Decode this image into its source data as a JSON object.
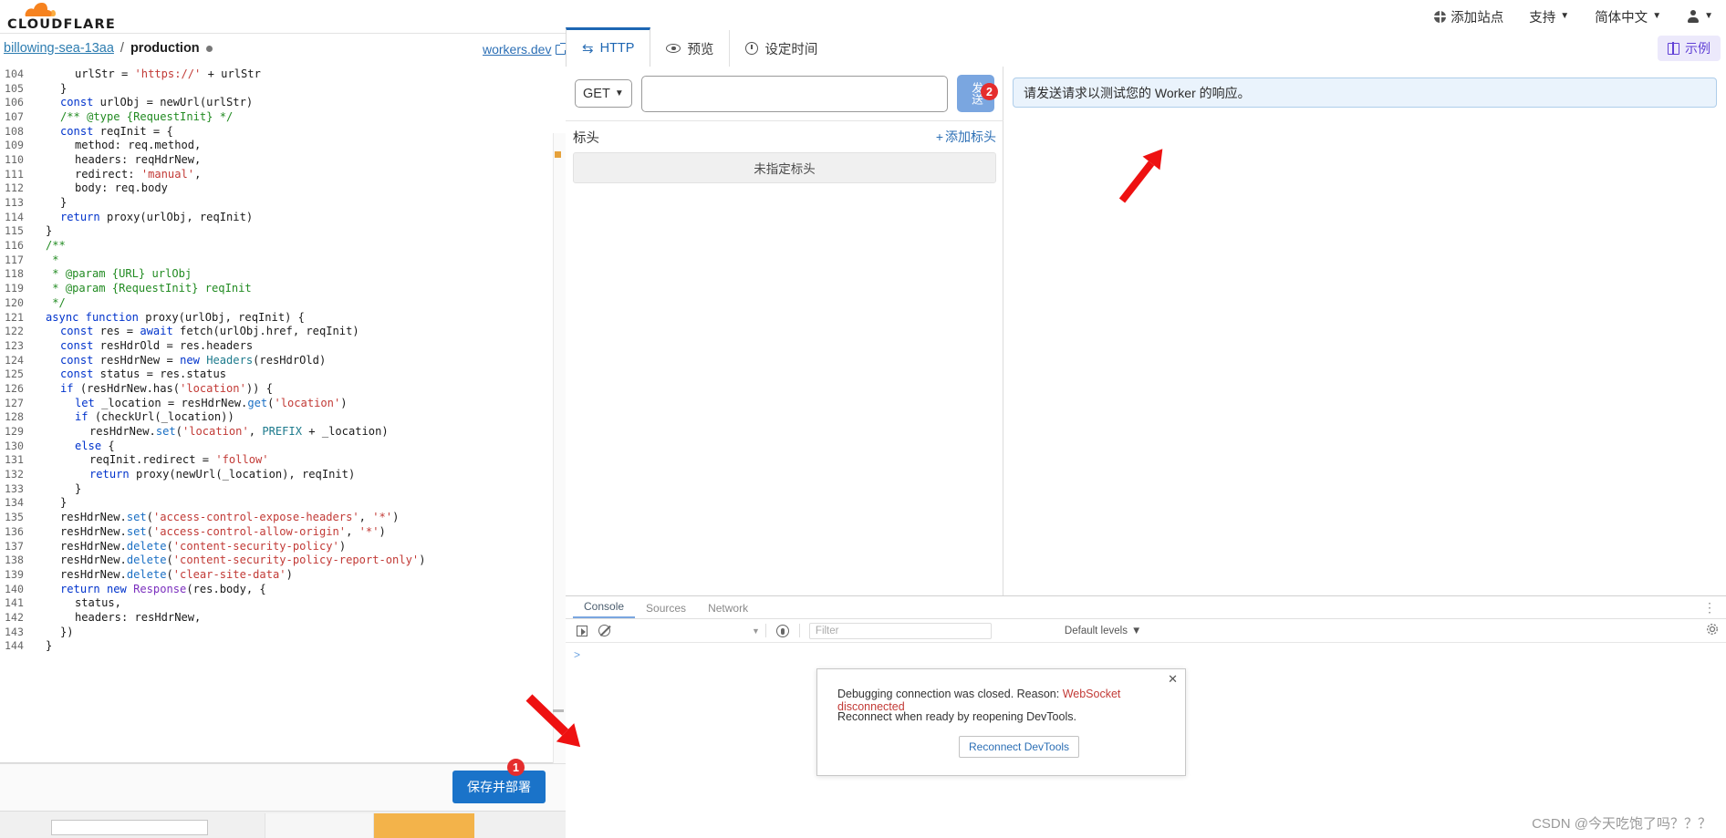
{
  "brand": {
    "name": "CLOUDFLARE",
    "color": "#f6821f"
  },
  "topnav": {
    "add_site": "添加站点",
    "support": "支持",
    "language": "简体中文",
    "caret": "▼"
  },
  "breadcrumb": {
    "worker_name": "billowing-sea-13aa",
    "separator": "/",
    "environment": "production",
    "workers_dev_link": "workers.dev"
  },
  "tabs": [
    {
      "label": "HTTP",
      "icon": "http-swap-icon",
      "active": true
    },
    {
      "label": "预览",
      "icon": "eye-icon",
      "active": false
    },
    {
      "label": "设定时间",
      "icon": "clock-icon",
      "active": false
    }
  ],
  "sample_button": {
    "label": "示例",
    "icon": "book-icon",
    "color": "#6141d6"
  },
  "request": {
    "method": "GET",
    "method_caret": "▼",
    "url_value": "",
    "url_placeholder": "",
    "send_label": "发送",
    "send_badge": "2",
    "headers_label": "标头",
    "add_header_label": "添加标头",
    "add_header_plus": "+",
    "no_headers_text": "未指定标头"
  },
  "response": {
    "message": "请发送请求以测试您的 Worker 的响应。"
  },
  "deploy": {
    "button_label": "保存并部署",
    "badge": "1"
  },
  "devtools": {
    "tabs": [
      "Console",
      "Sources",
      "Network"
    ],
    "active_tab": "Console",
    "kebab": "⋮",
    "toolbar": {
      "execution_context_caret": "▼",
      "filter_placeholder": "Filter",
      "levels_label": "Default levels",
      "levels_caret": "▼"
    },
    "prompt": ">",
    "popup": {
      "close": "✕",
      "line1_prefix": "Debugging connection was closed. Reason: ",
      "line1_error": "WebSocket disconnected",
      "line2": "Reconnect when ready by reopening DevTools.",
      "button_label": "Reconnect DevTools"
    }
  },
  "watermark": "CSDN @今天吃饱了吗？？？",
  "editor": {
    "first_line_number": 104,
    "lines": [
      {
        "n": 104,
        "indent": 3,
        "tokens": [
          {
            "t": "urlStr = ",
            "c": "codetext"
          },
          {
            "t": "'https://'",
            "c": "str"
          },
          {
            "t": " + urlStr",
            "c": "codetext"
          }
        ]
      },
      {
        "n": 105,
        "indent": 2,
        "tokens": [
          {
            "t": "}",
            "c": "codetext"
          }
        ]
      },
      {
        "n": 106,
        "indent": 2,
        "tokens": [
          {
            "t": "const",
            "c": "kw"
          },
          {
            "t": " urlObj = newUrl(urlStr)",
            "c": "codetext"
          }
        ]
      },
      {
        "n": 107,
        "indent": 2,
        "tokens": [
          {
            "t": "/** @type {RequestInit} */",
            "c": "cmt"
          }
        ]
      },
      {
        "n": 108,
        "indent": 2,
        "tokens": [
          {
            "t": "const",
            "c": "kw"
          },
          {
            "t": " reqInit = {",
            "c": "codetext"
          }
        ]
      },
      {
        "n": 109,
        "indent": 3,
        "tokens": [
          {
            "t": "method: req.method,",
            "c": "codetext"
          }
        ]
      },
      {
        "n": 110,
        "indent": 3,
        "tokens": [
          {
            "t": "headers: reqHdrNew,",
            "c": "codetext"
          }
        ]
      },
      {
        "n": 111,
        "indent": 3,
        "tokens": [
          {
            "t": "redirect: ",
            "c": "codetext"
          },
          {
            "t": "'manual'",
            "c": "str"
          },
          {
            "t": ",",
            "c": "codetext"
          }
        ]
      },
      {
        "n": 112,
        "indent": 3,
        "tokens": [
          {
            "t": "body: req.body",
            "c": "codetext"
          }
        ]
      },
      {
        "n": 113,
        "indent": 2,
        "tokens": [
          {
            "t": "}",
            "c": "codetext"
          }
        ]
      },
      {
        "n": 114,
        "indent": 2,
        "tokens": [
          {
            "t": "return",
            "c": "kw"
          },
          {
            "t": " proxy(urlObj, reqInit)",
            "c": "codetext"
          }
        ]
      },
      {
        "n": 115,
        "indent": 1,
        "tokens": [
          {
            "t": "}",
            "c": "codetext"
          }
        ]
      },
      {
        "n": 116,
        "indent": 1,
        "tokens": [
          {
            "t": "/**",
            "c": "cmt"
          }
        ]
      },
      {
        "n": 117,
        "indent": 1,
        "tokens": [
          {
            "t": " *",
            "c": "cmt"
          }
        ]
      },
      {
        "n": 118,
        "indent": 1,
        "tokens": [
          {
            "t": " * @param {URL} urlObj",
            "c": "cmt"
          }
        ]
      },
      {
        "n": 119,
        "indent": 1,
        "tokens": [
          {
            "t": " * @param {RequestInit} reqInit",
            "c": "cmt"
          }
        ]
      },
      {
        "n": 120,
        "indent": 1,
        "tokens": [
          {
            "t": " */",
            "c": "cmt"
          }
        ]
      },
      {
        "n": 121,
        "indent": 1,
        "tokens": [
          {
            "t": "async function",
            "c": "kw"
          },
          {
            "t": " proxy(urlObj, reqInit) {",
            "c": "codetext"
          }
        ]
      },
      {
        "n": 122,
        "indent": 2,
        "tokens": [
          {
            "t": "const",
            "c": "kw"
          },
          {
            "t": " res = ",
            "c": "codetext"
          },
          {
            "t": "await",
            "c": "kw"
          },
          {
            "t": " fetch(urlObj.href, reqInit)",
            "c": "codetext"
          }
        ]
      },
      {
        "n": 123,
        "indent": 2,
        "tokens": [
          {
            "t": "const",
            "c": "kw"
          },
          {
            "t": " resHdrOld = res.headers",
            "c": "codetext"
          }
        ]
      },
      {
        "n": 124,
        "indent": 2,
        "tokens": [
          {
            "t": "const",
            "c": "kw"
          },
          {
            "t": " resHdrNew = ",
            "c": "codetext"
          },
          {
            "t": "new",
            "c": "kw"
          },
          {
            "t": " ",
            "c": "codetext"
          },
          {
            "t": "Headers",
            "c": "typ"
          },
          {
            "t": "(resHdrOld)",
            "c": "codetext"
          }
        ]
      },
      {
        "n": 125,
        "indent": 2,
        "tokens": [
          {
            "t": "const",
            "c": "kw"
          },
          {
            "t": " status = res.status",
            "c": "codetext"
          }
        ]
      },
      {
        "n": 126,
        "indent": 2,
        "tokens": [
          {
            "t": "if",
            "c": "kw"
          },
          {
            "t": " (resHdrNew.has(",
            "c": "codetext"
          },
          {
            "t": "'location'",
            "c": "str"
          },
          {
            "t": ")) {",
            "c": "codetext"
          }
        ]
      },
      {
        "n": 127,
        "indent": 3,
        "tokens": [
          {
            "t": "let",
            "c": "kw"
          },
          {
            "t": " _location = resHdrNew.",
            "c": "codetext"
          },
          {
            "t": "get",
            "c": "fn"
          },
          {
            "t": "(",
            "c": "codetext"
          },
          {
            "t": "'location'",
            "c": "str"
          },
          {
            "t": ")",
            "c": "codetext"
          }
        ]
      },
      {
        "n": 128,
        "indent": 3,
        "tokens": [
          {
            "t": "if",
            "c": "kw"
          },
          {
            "t": " (checkUrl(_location))",
            "c": "codetext"
          }
        ]
      },
      {
        "n": 129,
        "indent": 4,
        "tokens": [
          {
            "t": "resHdrNew.",
            "c": "codetext"
          },
          {
            "t": "set",
            "c": "fn"
          },
          {
            "t": "(",
            "c": "codetext"
          },
          {
            "t": "'location'",
            "c": "str"
          },
          {
            "t": ", ",
            "c": "codetext"
          },
          {
            "t": "PREFIX",
            "c": "typ"
          },
          {
            "t": " + _location)",
            "c": "codetext"
          }
        ]
      },
      {
        "n": 130,
        "indent": 3,
        "tokens": [
          {
            "t": "else",
            "c": "kw"
          },
          {
            "t": " {",
            "c": "codetext"
          }
        ]
      },
      {
        "n": 131,
        "indent": 4,
        "tokens": [
          {
            "t": "reqInit.redirect = ",
            "c": "codetext"
          },
          {
            "t": "'follow'",
            "c": "str"
          }
        ]
      },
      {
        "n": 132,
        "indent": 4,
        "tokens": [
          {
            "t": "return",
            "c": "kw"
          },
          {
            "t": " proxy(newUrl(_location), reqInit)",
            "c": "codetext"
          }
        ]
      },
      {
        "n": 133,
        "indent": 3,
        "tokens": [
          {
            "t": "}",
            "c": "codetext"
          }
        ]
      },
      {
        "n": 134,
        "indent": 2,
        "tokens": [
          {
            "t": "}",
            "c": "codetext"
          }
        ]
      },
      {
        "n": 135,
        "indent": 2,
        "tokens": [
          {
            "t": "resHdrNew.",
            "c": "codetext"
          },
          {
            "t": "set",
            "c": "fn"
          },
          {
            "t": "(",
            "c": "codetext"
          },
          {
            "t": "'access-control-expose-headers'",
            "c": "str"
          },
          {
            "t": ", ",
            "c": "codetext"
          },
          {
            "t": "'*'",
            "c": "str"
          },
          {
            "t": ")",
            "c": "codetext"
          }
        ]
      },
      {
        "n": 136,
        "indent": 2,
        "tokens": [
          {
            "t": "resHdrNew.",
            "c": "codetext"
          },
          {
            "t": "set",
            "c": "fn"
          },
          {
            "t": "(",
            "c": "codetext"
          },
          {
            "t": "'access-control-allow-origin'",
            "c": "str"
          },
          {
            "t": ", ",
            "c": "codetext"
          },
          {
            "t": "'*'",
            "c": "str"
          },
          {
            "t": ")",
            "c": "codetext"
          }
        ]
      },
      {
        "n": 137,
        "indent": 2,
        "tokens": [
          {
            "t": "resHdrNew.",
            "c": "codetext"
          },
          {
            "t": "delete",
            "c": "fn"
          },
          {
            "t": "(",
            "c": "codetext"
          },
          {
            "t": "'content-security-policy'",
            "c": "str"
          },
          {
            "t": ")",
            "c": "codetext"
          }
        ]
      },
      {
        "n": 138,
        "indent": 2,
        "tokens": [
          {
            "t": "resHdrNew.",
            "c": "codetext"
          },
          {
            "t": "delete",
            "c": "fn"
          },
          {
            "t": "(",
            "c": "codetext"
          },
          {
            "t": "'content-security-policy-report-only'",
            "c": "str"
          },
          {
            "t": ")",
            "c": "codetext"
          }
        ]
      },
      {
        "n": 139,
        "indent": 2,
        "tokens": [
          {
            "t": "resHdrNew.",
            "c": "codetext"
          },
          {
            "t": "delete",
            "c": "fn"
          },
          {
            "t": "(",
            "c": "codetext"
          },
          {
            "t": "'clear-site-data'",
            "c": "str"
          },
          {
            "t": ")",
            "c": "codetext"
          }
        ]
      },
      {
        "n": 140,
        "indent": 2,
        "tokens": [
          {
            "t": "return",
            "c": "kw"
          },
          {
            "t": " ",
            "c": "codetext"
          },
          {
            "t": "new",
            "c": "kw"
          },
          {
            "t": " ",
            "c": "codetext"
          },
          {
            "t": "Response",
            "c": "pur"
          },
          {
            "t": "(res.body, {",
            "c": "codetext"
          }
        ]
      },
      {
        "n": 141,
        "indent": 3,
        "tokens": [
          {
            "t": "status,",
            "c": "codetext"
          }
        ]
      },
      {
        "n": 142,
        "indent": 3,
        "tokens": [
          {
            "t": "headers: resHdrNew,",
            "c": "codetext"
          }
        ]
      },
      {
        "n": 143,
        "indent": 2,
        "tokens": [
          {
            "t": "})",
            "c": "codetext"
          }
        ]
      },
      {
        "n": 144,
        "indent": 1,
        "tokens": [
          {
            "t": "}",
            "c": "codetext"
          }
        ]
      }
    ]
  }
}
